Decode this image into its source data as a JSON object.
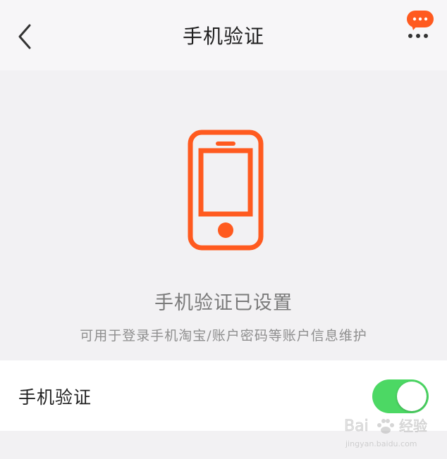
{
  "nav": {
    "title": "手机验证",
    "back_icon": "chevron-left-icon",
    "more_icon": "more-dots-icon",
    "message_icon": "message-badge-icon"
  },
  "status": {
    "icon": "mobile-phone-icon",
    "title": "手机验证已设置",
    "description": "可用于登录手机淘宝/账户密码等账户信息维护"
  },
  "setting": {
    "label": "手机验证",
    "enabled": true
  },
  "watermark": {
    "brand": "Baidu经验",
    "url": "jingyan.baidu.com"
  },
  "colors": {
    "accent": "#ff5a1f",
    "toggle_on": "#4cd864",
    "background": "#f2f1f3"
  }
}
